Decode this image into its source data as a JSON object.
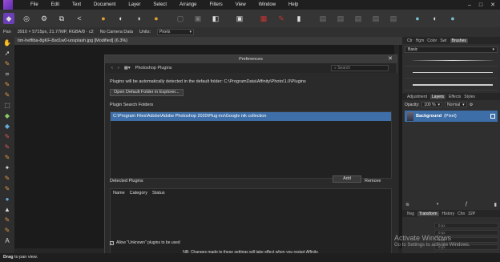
{
  "menubar": {
    "items": [
      "File",
      "Edit",
      "Text",
      "Document",
      "Layer",
      "Select",
      "Arrange",
      "Filters",
      "View",
      "Window",
      "Help"
    ],
    "window_controls": [
      "–",
      "□",
      "✕"
    ]
  },
  "context_bar": {
    "mode": "Pan",
    "doc_info": "3910 × 5715px, 21.77MP, RGBA/8 · c2",
    "camera": "No Camera Data",
    "units_label": "Units:",
    "units_value": "Pixels"
  },
  "document": {
    "tab_title": "tim-heffiba-8gKF-8xd1w0-unsplash.jpg [Modified] (6.3%)"
  },
  "status": {
    "action": "Drag",
    "hint": "to pan view."
  },
  "right_panel": {
    "top_tabs": [
      "Ctr",
      "Hgm",
      "Color",
      "Swt",
      "Brushes"
    ],
    "active_top_tab": "Brushes",
    "brush_category": "Basic",
    "layer_tabs": [
      "Adjustment",
      "Layers",
      "Effects",
      "Styles"
    ],
    "active_layer_tab": "Layers",
    "opacity_label": "Opacity:",
    "opacity_value": "100 %",
    "blend_mode": "Normal",
    "layer_name": "Background",
    "layer_type": "(Pixel)",
    "nav_tabs": [
      "Nvg",
      "Transform",
      "History",
      "Chn",
      "32P"
    ],
    "active_nav_tab": "Transform",
    "nav_values": [
      "0 px",
      "0 px",
      "0 px",
      "0 px",
      "0 °",
      "0 °"
    ]
  },
  "dialog": {
    "title": "Preferences",
    "section": "Photoshop Plugins",
    "search_placeholder": "Search",
    "info_text": "Plugins will be automatically detected in the default folder: C:\\ProgramData\\Affinity\\Photo\\1.0\\Plugins",
    "open_folder_label": "Open Default Folder in Explorer...",
    "search_folders_label": "Plugin Search Folders",
    "folder_path": "C:\\Program Files\\Adobe\\Adobe Photoshop 2020\\Plug-ins\\Google nik collection",
    "add_label": "Add",
    "remove_label": "Remove",
    "detected_label": "Detected Plugins",
    "columns": [
      "Name",
      "Category",
      "Status"
    ],
    "allow_unknown_label": "Allow \"Unknown\" plugins to be used",
    "note": "NB: Changes made to these settings will take effect when you restart Affinity."
  },
  "watermark": {
    "title": "Activate Windows",
    "subtitle": "Go to Settings to activate Windows."
  }
}
